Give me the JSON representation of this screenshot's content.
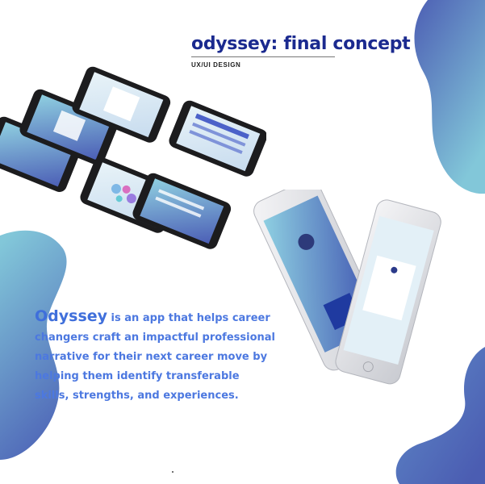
{
  "header": {
    "title": "odyssey: final concept",
    "subtitle": "UX/UI DESIGN"
  },
  "description": {
    "brand": "Odyssey",
    "text": " is an app that helps career changers craft an impactful professional narrative for their next career move by helping them identify transferable skills, strengths, and experiences."
  },
  "colors": {
    "title": "#1b2a8f",
    "body_text": "#4c78e0",
    "blob_light": "#7fc6d9",
    "blob_dark": "#4c62b6"
  }
}
